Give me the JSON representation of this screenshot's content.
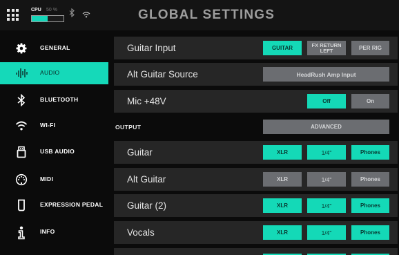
{
  "header": {
    "title": "GLOBAL SETTINGS",
    "cpu_label": "CPU",
    "cpu_percent_text": "50 %",
    "cpu_load": 0.5,
    "bluetooth_symbol": "✱"
  },
  "sidebar": {
    "items": [
      {
        "label": "GENERAL",
        "icon": "gear-icon",
        "active": false
      },
      {
        "label": "AUDIO",
        "icon": "audio-waveform-icon",
        "active": true
      },
      {
        "label": "BLUETOOTH",
        "icon": "bluetooth-icon",
        "active": false
      },
      {
        "label": "WI-FI",
        "icon": "wifi-icon",
        "active": false
      },
      {
        "label": "USB AUDIO",
        "icon": "usb-icon",
        "active": false
      },
      {
        "label": "MIDI",
        "icon": "midi-icon",
        "active": false
      },
      {
        "label": "EXPRESSION PEDAL",
        "icon": "expression-pedal-icon",
        "active": false
      },
      {
        "label": "INFO",
        "icon": "info-icon",
        "active": false
      }
    ]
  },
  "settings": {
    "guitar_input": {
      "label": "Guitar Input",
      "options": [
        "GUITAR",
        "FX RETURN LEFT",
        "PER RIG"
      ],
      "fx_line1": "FX RETURN",
      "fx_line2": "LEFT",
      "selected": "GUITAR"
    },
    "alt_guitar_source": {
      "label": "Alt Guitar Source",
      "value": "HeadRush Amp Input"
    },
    "mic_48v": {
      "label": "Mic +48V",
      "off_label": "Off",
      "on_label": "On",
      "selected": "Off"
    },
    "output": {
      "label": "OUTPUT",
      "advanced_label": "ADVANCED"
    },
    "outputs": [
      {
        "label": "Guitar",
        "xlr": "XLR",
        "quarter": "1/4\"",
        "phones": "Phones",
        "xlr_on": true,
        "quarter_on": true,
        "phones_on": true
      },
      {
        "label": "Alt Guitar",
        "xlr": "XLR",
        "quarter": "1/4\"",
        "phones": "Phones",
        "xlr_on": false,
        "quarter_on": false,
        "phones_on": false
      },
      {
        "label": "Guitar (2)",
        "xlr": "XLR",
        "quarter": "1/4\"",
        "phones": "Phones",
        "xlr_on": true,
        "quarter_on": true,
        "phones_on": true
      },
      {
        "label": "Vocals",
        "xlr": "XLR",
        "quarter": "1/4\"",
        "phones": "Phones",
        "xlr_on": true,
        "quarter_on": true,
        "phones_on": true
      }
    ]
  },
  "colors": {
    "accent": "#14d9b7",
    "inactive_button": "#6b6d71",
    "row_background": "#262626",
    "background": "#0b0b0b"
  }
}
